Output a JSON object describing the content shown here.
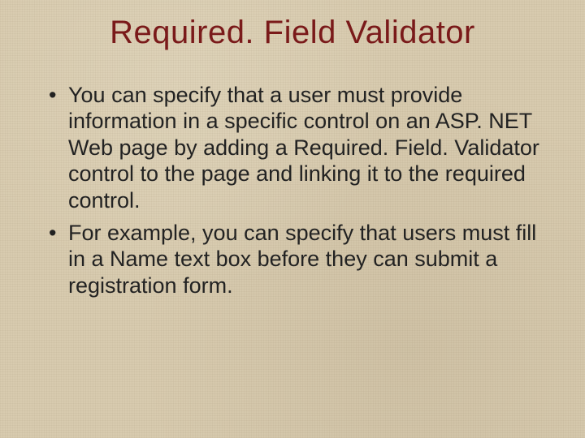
{
  "slide": {
    "title": "Required. Field Validator",
    "bullets": [
      "You can specify that a user must provide information in a specific control on an ASP. NET Web page by adding a Required. Field. Validator control to the page and linking it to the required control.",
      "For example, you can specify that users must fill in a Name text box before they can submit a registration form."
    ]
  }
}
